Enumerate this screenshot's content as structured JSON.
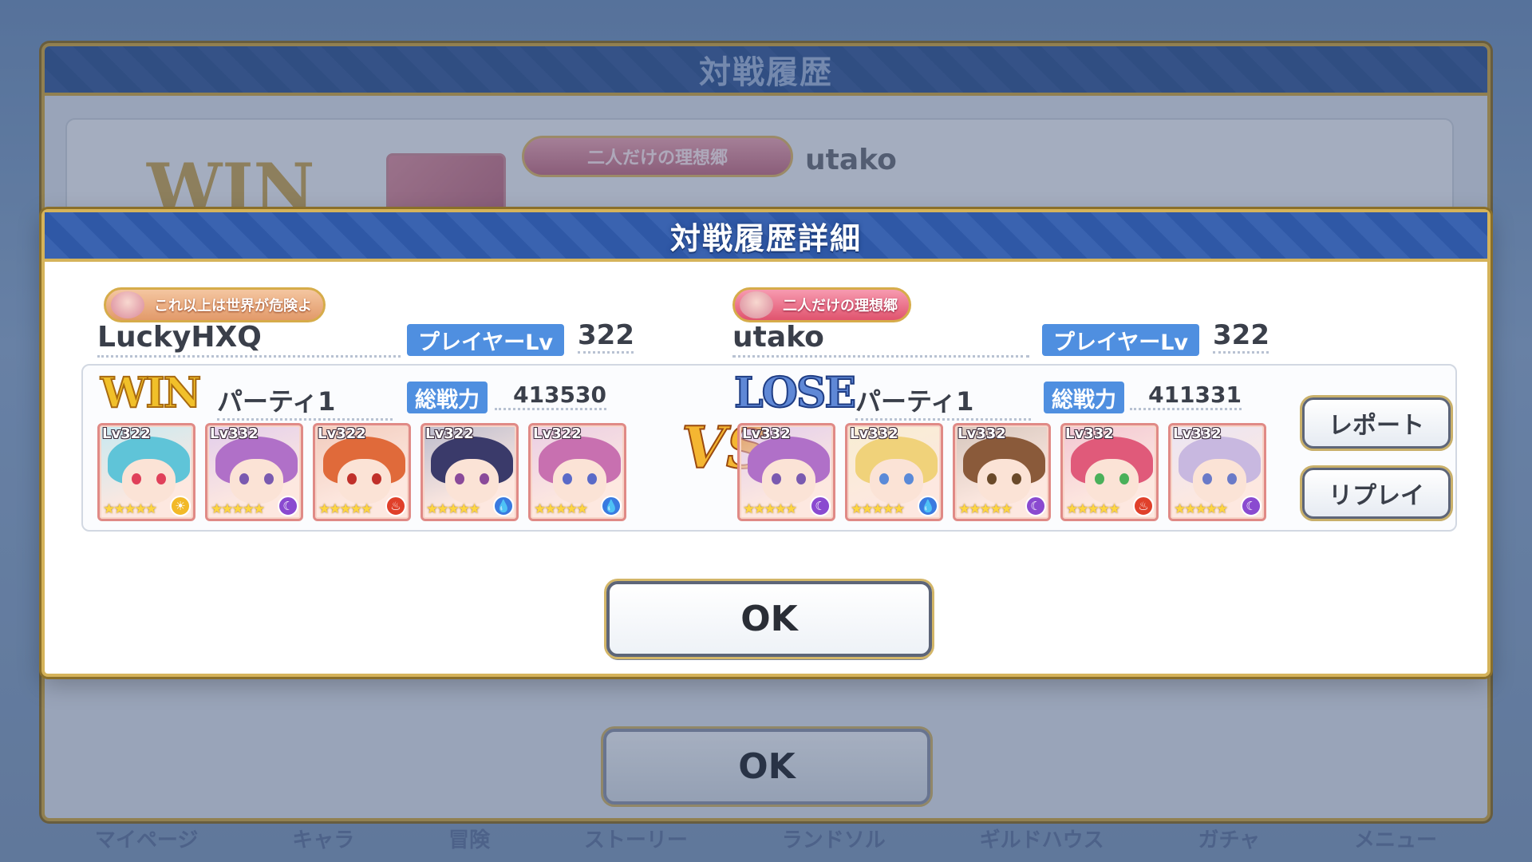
{
  "background": {
    "nav_items": [
      "マイページ",
      "キャラ",
      "冒険",
      "ストーリー",
      "ランドソル",
      "ギルドハウス",
      "ガチャ",
      "メニュー"
    ]
  },
  "history_dialog": {
    "title": "対戦履歴",
    "result": "WIN",
    "opponent_title": "二人だけの理想郷",
    "opponent_name": "utako",
    "ok_label": "OK"
  },
  "detail_dialog": {
    "title": "対戦履歴詳細",
    "left": {
      "title_badge": "これ以上は世界が危険よ",
      "name": "LuckyHXQ",
      "level_label": "プレイヤーLv",
      "level": "322",
      "result": "WIN",
      "party_name": "パーティ1",
      "power_label": "総戦力",
      "power": "413530",
      "units": [
        {
          "lv": "Lv322",
          "stars": "★★★★★",
          "element": "light",
          "hair": "#5fc4d8",
          "eyes": "#e0405a"
        },
        {
          "lv": "Lv332",
          "stars": "★★★★★",
          "element": "dark",
          "hair": "#b070c8",
          "eyes": "#7a5ab0"
        },
        {
          "lv": "Lv322",
          "stars": "★★★★★",
          "element": "fire",
          "hair": "#e06a3a",
          "eyes": "#c0302a"
        },
        {
          "lv": "Lv322",
          "stars": "★★★★★",
          "element": "water",
          "hair": "#3a3a6a",
          "eyes": "#8a4a9a"
        },
        {
          "lv": "Lv322",
          "stars": "★★★★★",
          "element": "water",
          "hair": "#c870b0",
          "eyes": "#5a6ac8"
        }
      ]
    },
    "vs_label": "VS",
    "right": {
      "title_badge": "二人だけの理想郷",
      "name": "utako",
      "level_label": "プレイヤーLv",
      "level": "322",
      "result": "LOSE",
      "party_name": "パーティ1",
      "power_label": "総戦力",
      "power": "411331",
      "units": [
        {
          "lv": "Lv332",
          "stars": "★★★★★",
          "element": "dark",
          "hair": "#b070c8",
          "eyes": "#7a5ab0"
        },
        {
          "lv": "Lv332",
          "stars": "★★★★★",
          "element": "water",
          "hair": "#f0d27a",
          "eyes": "#5a8ad8"
        },
        {
          "lv": "Lv332",
          "stars": "★★★★★",
          "element": "dark",
          "hair": "#8a5a3a",
          "eyes": "#6a4a2a"
        },
        {
          "lv": "Lv332",
          "stars": "★★★★★",
          "element": "fire",
          "hair": "#e05a7a",
          "eyes": "#4ab05a"
        },
        {
          "lv": "Lv332",
          "stars": "★★★★★",
          "element": "dark",
          "hair": "#c8b8e0",
          "eyes": "#6a7ac8"
        }
      ]
    },
    "report_label": "レポート",
    "replay_label": "リプレイ",
    "ok_label": "OK"
  },
  "element_colors": {
    "light": "#f2b928",
    "dark": "#8a4ad0",
    "fire": "#e0402a",
    "water": "#3a7ae0"
  },
  "element_glyphs": {
    "light": "☀",
    "dark": "☾",
    "fire": "♨",
    "water": "💧"
  }
}
